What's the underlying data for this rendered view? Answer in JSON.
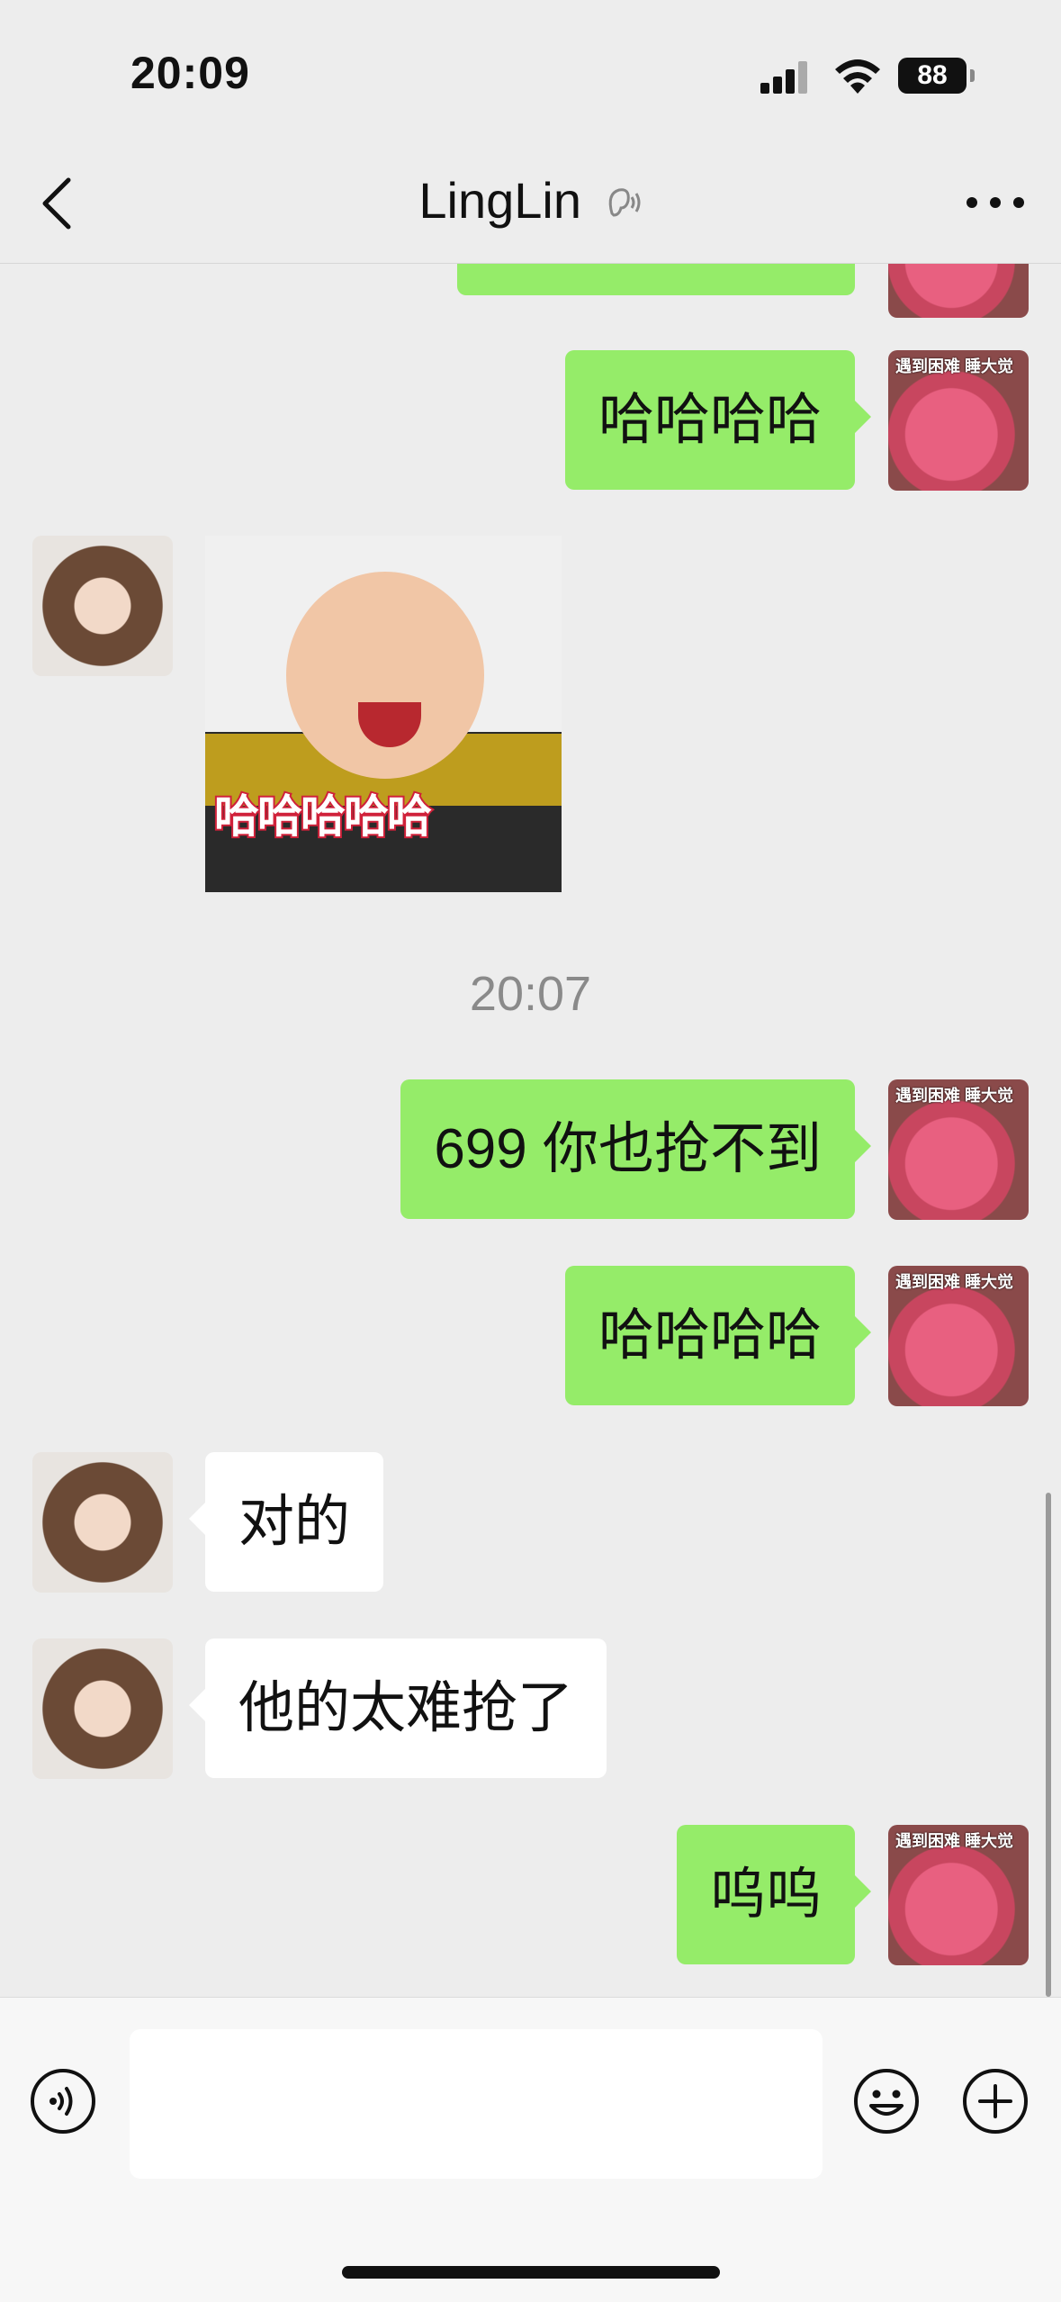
{
  "status": {
    "time": "20:09",
    "battery": "88"
  },
  "header": {
    "title": "LingLin"
  },
  "messages": {
    "m0": "",
    "m1": "哈哈哈哈",
    "sticker_caption": "哈哈哈哈哈",
    "timestamp": "20:07",
    "m2": "699 你也抢不到",
    "m3": "哈哈哈哈",
    "m4": "对的",
    "m5": "他的太难抢了",
    "m6": "呜呜"
  },
  "avatar_tag": "遇到困难 睡大觉",
  "input": {
    "value": ""
  },
  "colors": {
    "bubble_me": "#95ec69",
    "bubble_other": "#ffffff",
    "background": "#ededed"
  }
}
